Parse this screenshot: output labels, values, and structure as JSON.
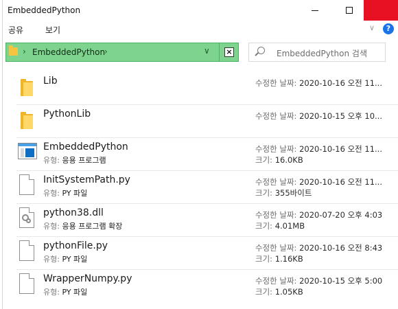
{
  "window": {
    "title": "EmbeddedPython"
  },
  "ribbon": {
    "share_tab": "공유",
    "view_tab": "보기"
  },
  "address": {
    "path": "EmbeddedPython"
  },
  "search": {
    "placeholder": "EmbeddedPython 검색"
  },
  "labels": {
    "modified": "수정한 날짜:",
    "type": "유형:",
    "size": "크기:"
  },
  "files": [
    {
      "name": "Lib",
      "icon": "folder-icon",
      "modified": "2020-10-16 오전 11..."
    },
    {
      "name": "PythonLib",
      "icon": "folder-icon",
      "modified": "2020-10-15 오후 10..."
    },
    {
      "name": "EmbeddedPython",
      "icon": "application-icon",
      "type": "응용 프로그램",
      "modified": "2020-10-16 오전 11...",
      "size": "16.0KB"
    },
    {
      "name": "InitSystemPath.py",
      "icon": "document-icon",
      "type": "PY 파일",
      "modified": "2020-10-16 오전 11...",
      "size": "355바이트"
    },
    {
      "name": "python38.dll",
      "icon": "dll-gear-icon",
      "type": "응용 프로그램 확장",
      "modified": "2020-07-20 오후 4:03",
      "size": "4.01MB"
    },
    {
      "name": "pythonFile.py",
      "icon": "document-icon",
      "type": "PY 파일",
      "modified": "2020-10-16 오전 8:43",
      "size": "1.16KB"
    },
    {
      "name": "WrapperNumpy.py",
      "icon": "document-icon",
      "type": "PY 파일",
      "modified": "2020-10-15 오후 5:00",
      "size": "1.05KB"
    }
  ],
  "colors": {
    "address_highlight": "#7ed38e",
    "close_button": "#e81123",
    "help_button": "#1a73e8"
  }
}
